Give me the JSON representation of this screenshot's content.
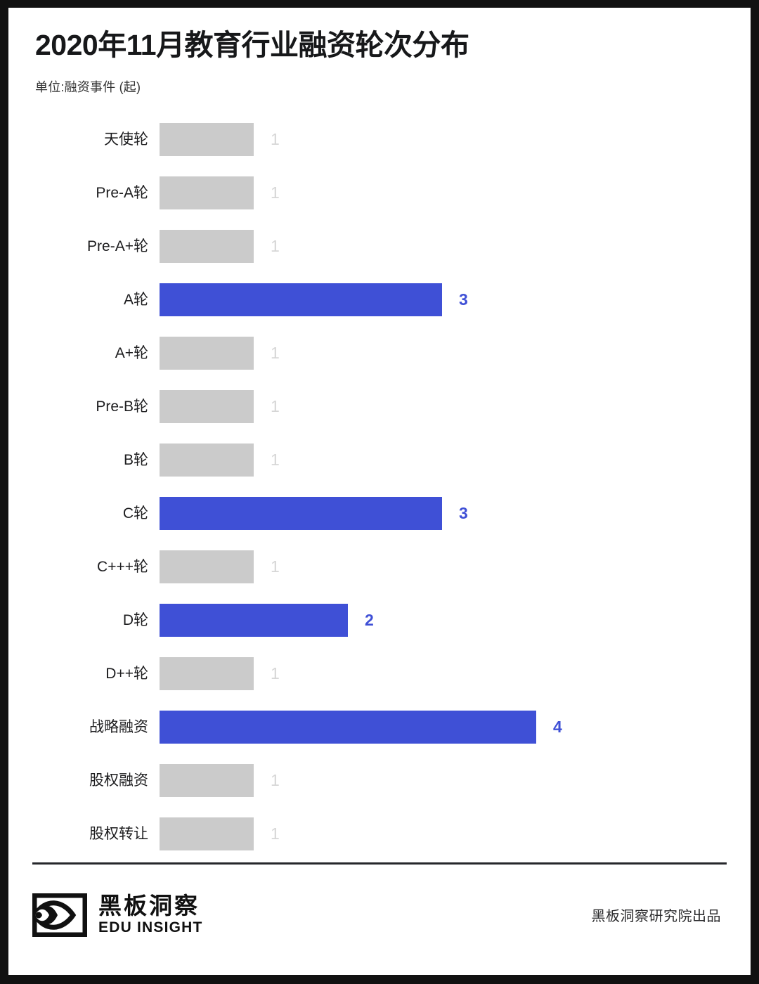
{
  "header": {
    "title": "2020年11月教育行业融资轮次分布",
    "subtitle": "单位:融资事件 (起)"
  },
  "colors": {
    "highlight": "#3f50d6",
    "muted": "#cbcbcb",
    "muted_label": "#d6d6d6",
    "page_border": "#111111",
    "card_background": "#ffffff",
    "divider": "#26272b"
  },
  "footer": {
    "brand_cn": "黑板洞察",
    "brand_en": "EDU INSIGHT",
    "credit": "黑板洞察研究院出品"
  },
  "chart_data": {
    "type": "bar",
    "orientation": "horizontal",
    "title": "2020年11月教育行业融资轮次分布",
    "subtitle": "单位:融资事件 (起)",
    "xlabel": "",
    "ylabel": "",
    "unit": "起",
    "grid": false,
    "legend": false,
    "xlim": [
      0,
      4
    ],
    "categories": [
      "天使轮",
      "Pre-A轮",
      "Pre-A+轮",
      "A轮",
      "A+轮",
      "Pre-B轮",
      "B轮",
      "C轮",
      "C+++轮",
      "D轮",
      "D++轮",
      "战略融资",
      "股权融资",
      "股权转让"
    ],
    "values": [
      1,
      1,
      1,
      3,
      1,
      1,
      1,
      3,
      1,
      2,
      1,
      4,
      1,
      1
    ],
    "bars": [
      {
        "label": "天使轮",
        "value": 1,
        "highlight": false
      },
      {
        "label": "Pre-A轮",
        "value": 1,
        "highlight": false
      },
      {
        "label": "Pre-A+轮",
        "value": 1,
        "highlight": false
      },
      {
        "label": "A轮",
        "value": 3,
        "highlight": true
      },
      {
        "label": "A+轮",
        "value": 1,
        "highlight": false
      },
      {
        "label": "Pre-B轮",
        "value": 1,
        "highlight": false
      },
      {
        "label": "B轮",
        "value": 1,
        "highlight": false
      },
      {
        "label": "C轮",
        "value": 3,
        "highlight": true
      },
      {
        "label": "C+++轮",
        "value": 1,
        "highlight": false
      },
      {
        "label": "D轮",
        "value": 2,
        "highlight": true
      },
      {
        "label": "D++轮",
        "value": 1,
        "highlight": false
      },
      {
        "label": "战略融资",
        "value": 4,
        "highlight": true
      },
      {
        "label": "股权融资",
        "value": 1,
        "highlight": false
      },
      {
        "label": "股权转让",
        "value": 1,
        "highlight": false
      }
    ]
  }
}
